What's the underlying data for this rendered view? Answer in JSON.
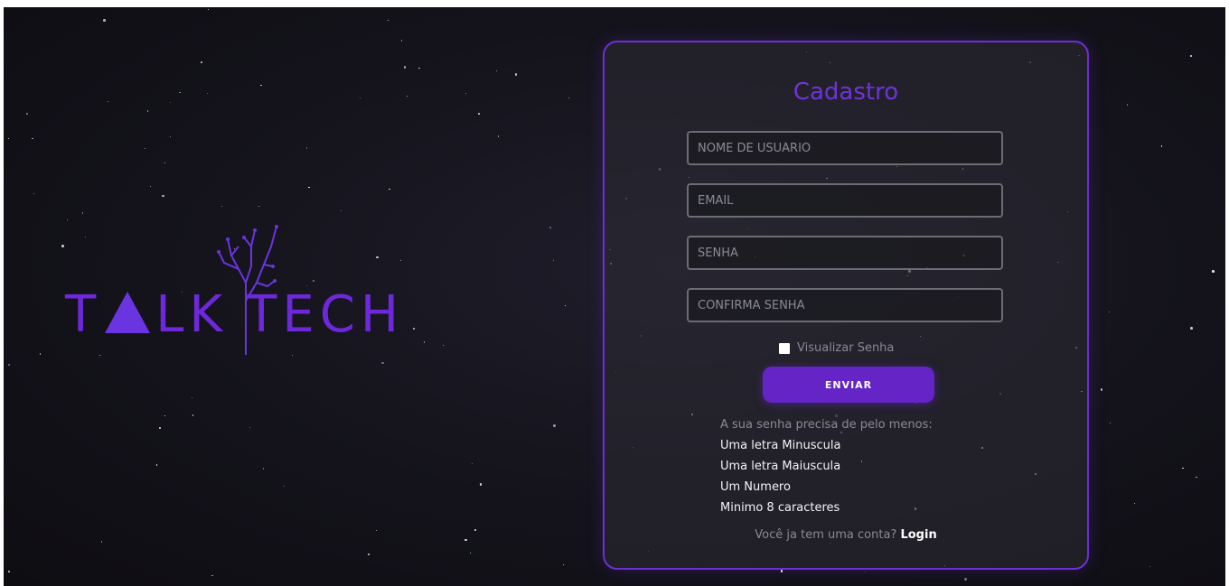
{
  "brand": {
    "logo_text_left": "T",
    "logo_text_mid": "LK",
    "logo_text_right": "TECH",
    "logo_full": "TALKTECH",
    "accent_color": "#6d28d9"
  },
  "form": {
    "title": "Cadastro",
    "username_placeholder": "NOME DE USUÁRIO",
    "email_placeholder": "EMAIL",
    "password_placeholder": "SENHA",
    "confirm_placeholder": "CONFIRMA SENHA",
    "show_password_label": "Visualizar Senha",
    "show_password_checked": false,
    "submit_label": "ENVIAR"
  },
  "password_rules": {
    "heading": "A sua senha precisa de pelo menos:",
    "items": [
      "Uma letra Minuscula",
      "Uma letra Maiuscula",
      "Um Numero",
      "Minimo 8 caracteres"
    ]
  },
  "footer": {
    "question": "Você ja tem uma conta?",
    "login_link": "Login"
  }
}
